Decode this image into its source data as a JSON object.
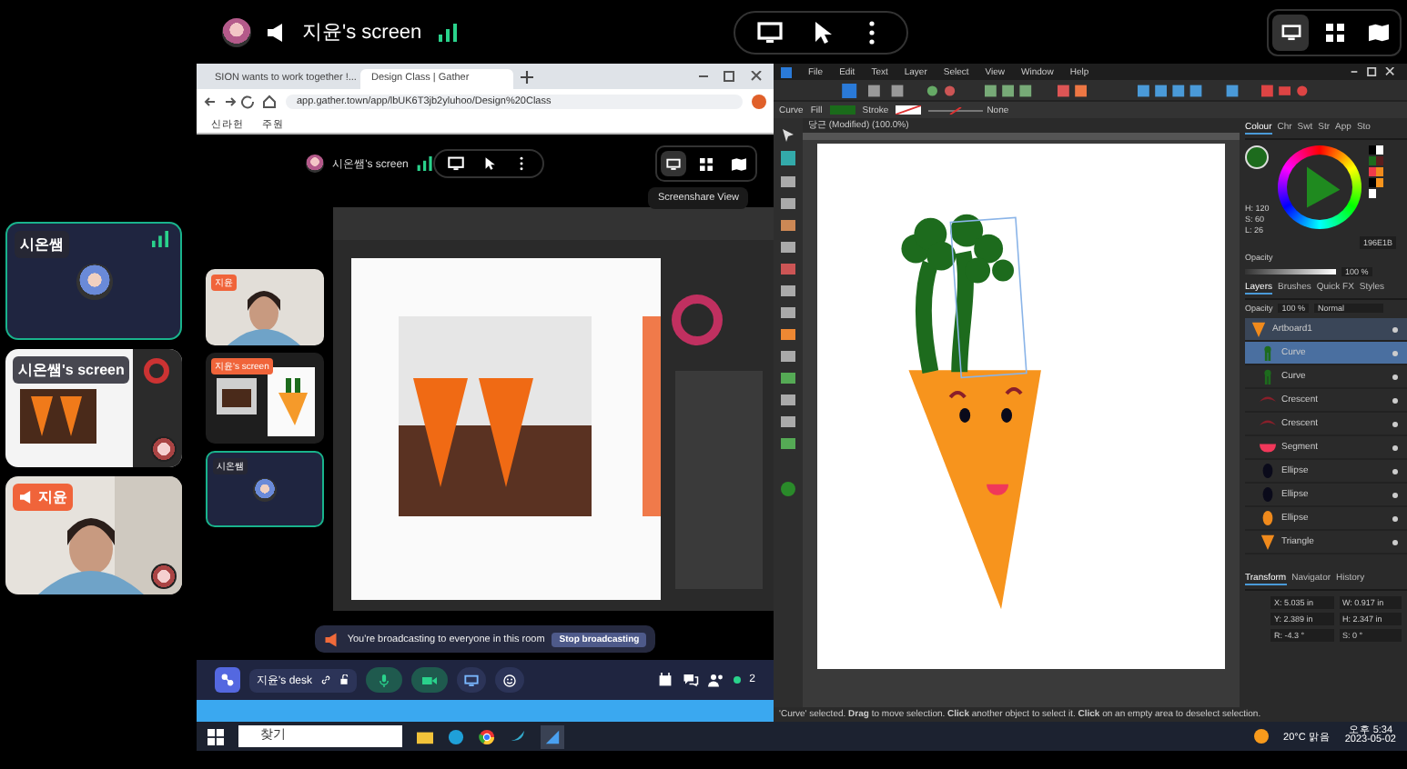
{
  "top_bar": {
    "title": "지윤's screen",
    "view_modes": [
      {
        "selected": true
      },
      {
        "selected": false
      },
      {
        "selected": false
      }
    ]
  },
  "participants": [
    {
      "kind": "avatar",
      "name": "시온쌤",
      "broadcasting": false
    },
    {
      "kind": "screen",
      "name": "시온쌤's screen",
      "broadcasting": false
    },
    {
      "kind": "video",
      "name": "지윤",
      "broadcasting": true
    }
  ],
  "browser": {
    "tabs": [
      {
        "title": "SION wants to work together !...",
        "selected": false
      },
      {
        "title": "Design Class | Gather",
        "selected": true
      }
    ],
    "url": "app.gather.town/app/lbUK6T3jb2yluhoo/Design%20Class",
    "bookmarks": [
      "신라헌",
      "주원"
    ]
  },
  "gather": {
    "title": "시온쌤's screen",
    "tooltip": "Screenshare View",
    "view_modes": [
      {
        "selected": true
      },
      {
        "selected": false
      },
      {
        "selected": false
      }
    ],
    "tiles": [
      {
        "kind": "video",
        "name": "지윤",
        "broadcasting": true
      },
      {
        "kind": "screen",
        "name": "지윤's screen",
        "broadcasting": true
      },
      {
        "kind": "avatar",
        "name": "시온쌤",
        "broadcasting": false
      }
    ],
    "banner": "You're broadcasting to everyone in this room",
    "banner_button": "Stop broadcasting",
    "desk": "지윤's desk",
    "people_count": "2",
    "mic_on": true,
    "camera_on": true
  },
  "designer": {
    "menu": [
      "File",
      "Edit",
      "Text",
      "Layer",
      "Select",
      "View",
      "Window",
      "Help"
    ],
    "context": {
      "tool": "Curve",
      "fill": "Fill",
      "stroke": "Stroke",
      "stroke_style": "None"
    },
    "document_tab": "당근 (Modified) (100.0%)",
    "colour_tabs": [
      {
        "label": "Colour",
        "selected": true
      },
      {
        "label": "Chr",
        "selected": false
      },
      {
        "label": "Swt",
        "selected": false
      },
      {
        "label": "Str",
        "selected": false
      },
      {
        "label": "App",
        "selected": false
      },
      {
        "label": "Sto",
        "selected": false
      }
    ],
    "hsl": [
      "H: 120",
      "S: 60",
      "L: 26"
    ],
    "hex": "196E1B",
    "opacity": "Opacity",
    "opacity_value": "100 %",
    "opacity_slider": {
      "level": 1
    },
    "layer_tabs": [
      {
        "label": "Layers",
        "selected": true
      },
      {
        "label": "Brushes",
        "selected": false
      },
      {
        "label": "Quick FX",
        "selected": false
      },
      {
        "label": "Styles",
        "selected": false
      }
    ],
    "layer_opacity": "Opacity",
    "layer_opacity_value": "100 %",
    "blend": "Normal",
    "layers": [
      {
        "name": "Artboard1",
        "kind": "artboard",
        "color": "#f08a1c",
        "selected": false
      },
      {
        "name": "Curve",
        "kind": "curve",
        "color": "#1d6b1d",
        "selected": true
      },
      {
        "name": "Curve",
        "kind": "curve",
        "color": "#1d6b1d",
        "selected": false
      },
      {
        "name": "Crescent",
        "kind": "crescent",
        "color": "#8a1f2a",
        "selected": false
      },
      {
        "name": "Crescent",
        "kind": "crescent",
        "color": "#8a1f2a",
        "selected": false
      },
      {
        "name": "Segment",
        "kind": "segment",
        "color": "#f0385a",
        "selected": false
      },
      {
        "name": "Ellipse",
        "kind": "ellipse",
        "color": "#0a0a1a",
        "selected": false
      },
      {
        "name": "Ellipse",
        "kind": "ellipse",
        "color": "#0a0a1a",
        "selected": false
      },
      {
        "name": "Ellipse",
        "kind": "ellipse",
        "color": "#f08a1c",
        "selected": false
      },
      {
        "name": "Triangle",
        "kind": "triangle",
        "color": "#f08a1c",
        "selected": false
      }
    ],
    "transform_tabs": [
      {
        "label": "Transform",
        "selected": true
      },
      {
        "label": "Navigator",
        "selected": false
      },
      {
        "label": "History",
        "selected": false
      }
    ],
    "transform": [
      {
        "label": "X:",
        "value": "5.035 in"
      },
      {
        "label": "W:",
        "value": "0.917 in"
      },
      {
        "label": "Y:",
        "value": "2.389 in"
      },
      {
        "label": "H:",
        "value": "2.347 in"
      },
      {
        "label": "R:",
        "value": "-4.3 °"
      },
      {
        "label": "S:",
        "value": "0 °"
      }
    ],
    "status": "'Curve' selected. **Drag** to move selection. **Click** another object to select it. **Click** on an empty area to deselect selection."
  },
  "taskbar": {
    "search": "찾기",
    "weather": "20°C 맑음",
    "time": "오후 5:34",
    "date": "2023-05-02"
  }
}
